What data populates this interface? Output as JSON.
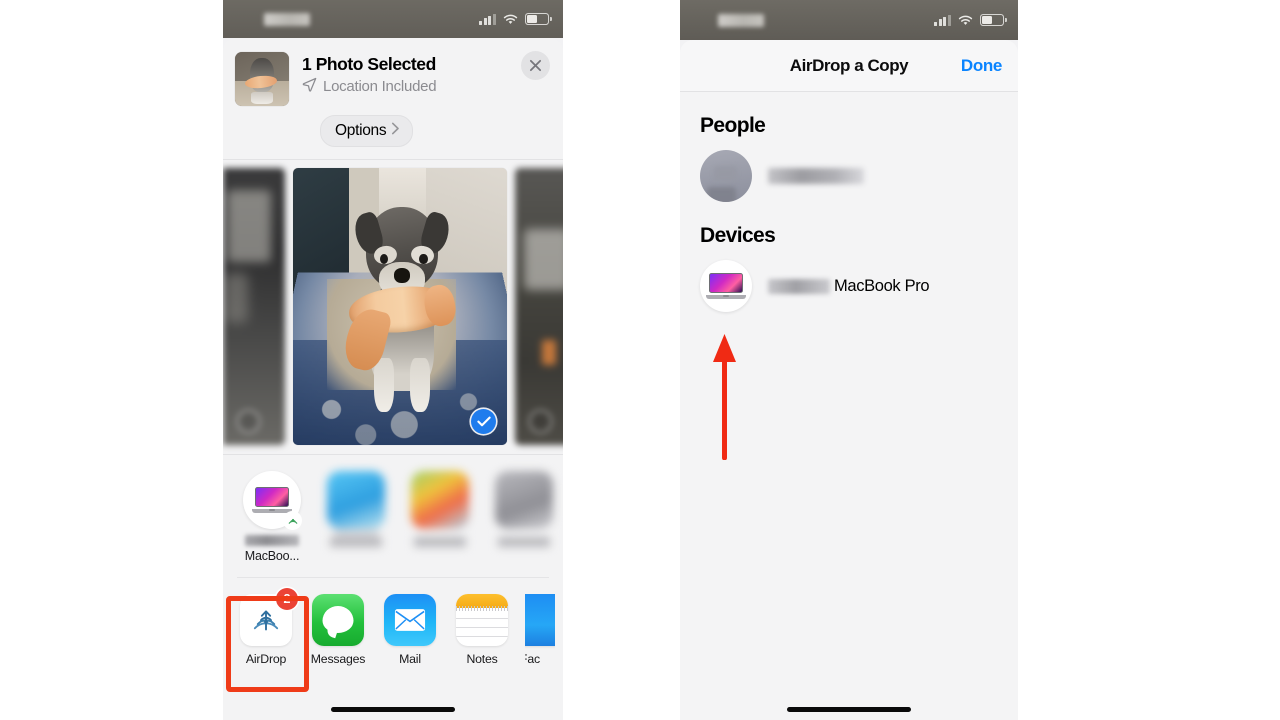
{
  "left_phone": {
    "status_bar": {
      "time": "",
      "signal_icon": "cellular-signal-icon",
      "wifi_icon": "wifi-icon",
      "battery_icon": "battery-icon"
    },
    "share_sheet": {
      "title": "1 Photo Selected",
      "subtitle": "Location Included",
      "location_icon": "location-arrow-icon",
      "close_icon": "close-icon",
      "options_label": "Options",
      "options_chevron": "chevron-right-icon",
      "thumbnail_name": "selected-photo-thumbnail"
    },
    "photo_strip": {
      "photos": [
        {
          "name": "photo-previous",
          "selected": false,
          "blurred": true
        },
        {
          "name": "photo-dog-with-toy",
          "selected": true,
          "blurred": false
        },
        {
          "name": "photo-next",
          "selected": false,
          "blurred": true
        }
      ]
    },
    "suggestions": [
      {
        "name": "MacBoo...",
        "icon": "macbook-pro-icon",
        "badge_icon": "airdrop-icon",
        "blurred": false
      },
      {
        "name": "",
        "icon": "contact-suggestion-icon",
        "blurred": true
      },
      {
        "name": "",
        "icon": "contact-suggestion-icon",
        "blurred": true
      },
      {
        "name": "",
        "icon": "contact-suggestion-icon",
        "blurred": true
      },
      {
        "name": "",
        "icon": "contact-suggestion-icon",
        "blurred": true
      }
    ],
    "apps": [
      {
        "label": "AirDrop",
        "icon": "airdrop-icon",
        "badge": "2",
        "highlighted": true
      },
      {
        "label": "Messages",
        "icon": "messages-icon",
        "badge": "",
        "highlighted": false
      },
      {
        "label": "Mail",
        "icon": "mail-icon",
        "badge": "",
        "highlighted": false
      },
      {
        "label": "Notes",
        "icon": "notes-icon",
        "badge": "",
        "highlighted": false
      },
      {
        "label": "Fac",
        "icon": "facetime-icon",
        "badge": "",
        "highlighted": false
      }
    ],
    "home_indicator": "home-indicator"
  },
  "right_phone": {
    "status_bar": {
      "time": "",
      "signal_icon": "cellular-signal-icon",
      "wifi_icon": "wifi-icon",
      "battery_icon": "battery-icon"
    },
    "airdrop_sheet": {
      "title": "AirDrop a Copy",
      "done_label": "Done",
      "people_heading": "People",
      "people": [
        {
          "name": "",
          "avatar": "person-avatar",
          "blurred": true
        }
      ],
      "devices_heading": "Devices",
      "devices": [
        {
          "name_blurred": "",
          "name": "MacBook Pro",
          "icon": "macbook-pro-icon"
        }
      ]
    },
    "home_indicator": "home-indicator"
  },
  "annotations": {
    "highlight_box": {
      "name": "airdrop-app-highlight",
      "color": "#ef3b18"
    },
    "arrow": {
      "name": "pointer-arrow-to-macbook-device",
      "color": "#f02a14",
      "direction": "up"
    }
  },
  "colors": {
    "accent_blue": "#0a84ff",
    "selection_blue": "#1f7ced",
    "annotation_red": "#ef3b18",
    "badge_red": "#eb4336",
    "sheet_bg": "#f3f3f4",
    "page_bg": "#ffffff"
  }
}
